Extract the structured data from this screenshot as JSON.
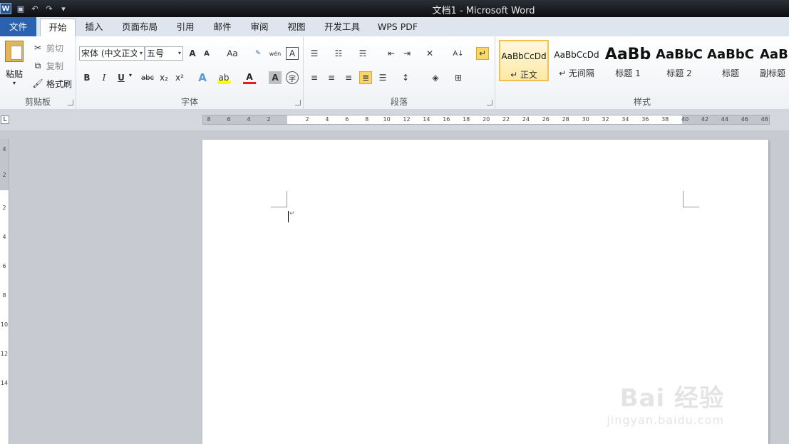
{
  "window": {
    "title": "文档1 - Microsoft Word"
  },
  "tabs": [
    {
      "label": "文件"
    },
    {
      "label": "开始"
    },
    {
      "label": "插入"
    },
    {
      "label": "页面布局"
    },
    {
      "label": "引用"
    },
    {
      "label": "邮件"
    },
    {
      "label": "审阅"
    },
    {
      "label": "视图"
    },
    {
      "label": "开发工具"
    },
    {
      "label": "WPS PDF"
    }
  ],
  "clipboard": {
    "paste": "粘贴",
    "cut": "剪切",
    "copy": "复制",
    "format_painter": "格式刷",
    "group": "剪贴板"
  },
  "font": {
    "name": "宋体 (中文正文)",
    "size": "五号",
    "group": "字体",
    "bold": "B",
    "italic": "I",
    "underline": "U",
    "strike": "abc",
    "sub": "x₂",
    "sup": "x²",
    "grow": "A",
    "shrink": "A",
    "case": "Aa",
    "pinyin": "wén",
    "phonetic": "文",
    "border": "A",
    "clear": "A",
    "char_shade": "A",
    "enclose": "字"
  },
  "paragraph": {
    "group": "段落"
  },
  "styles": {
    "group": "样式",
    "items": [
      {
        "preview": "AaBbCcDd",
        "label": "↵ 正文"
      },
      {
        "preview": "AaBbCcDd",
        "label": "↵ 无间隔"
      },
      {
        "preview": "AaBb",
        "label": "标题 1"
      },
      {
        "preview": "AaBbC",
        "label": "标题 2"
      },
      {
        "preview": "AaBbC",
        "label": "标题"
      },
      {
        "preview": "AaB",
        "label": "副标题"
      }
    ]
  },
  "ruler": {
    "h_ticks": [
      "8",
      "6",
      "4",
      "2",
      "2",
      "4",
      "6",
      "8",
      "10",
      "12",
      "14",
      "16",
      "18",
      "20",
      "22",
      "24",
      "26",
      "28",
      "30",
      "32",
      "34",
      "36",
      "38",
      "40",
      "42",
      "44",
      "46",
      "48"
    ],
    "v_ticks": [
      "4",
      "2",
      "2",
      "4",
      "6",
      "8",
      "10",
      "12",
      "14"
    ]
  },
  "document": {
    "paragraph_mark": "↵"
  },
  "watermark": {
    "brand": "Bai 经验",
    "url": "jingyan.baidu.com"
  },
  "colors": {
    "file_tab": "#2b62b0",
    "accent": "#fbd66b"
  }
}
